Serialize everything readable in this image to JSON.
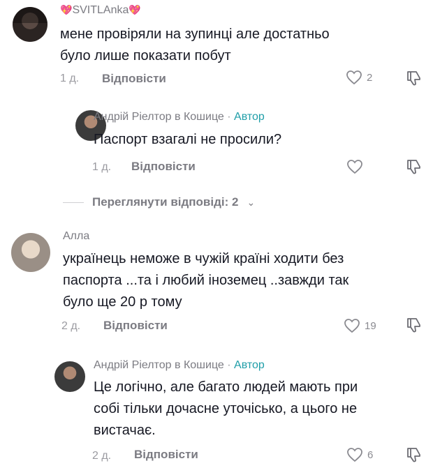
{
  "comments": [
    {
      "user": "SVITLAnka",
      "lines": [
        "мене провіряли на зупинці але достатньо",
        "було лише показати побут"
      ],
      "age": "1 д.",
      "reply": "Відповісти",
      "likes": "2"
    },
    {
      "user": "Андрій Ріелтор в Кошице",
      "author": "Автор",
      "lines": [
        "Паспорт взагалі не просили?"
      ],
      "age": "1 д.",
      "reply": "Відповісти",
      "likes": ""
    },
    {
      "user": "Алла",
      "lines": [
        "українець неможе в чужій країні ходити без",
        "паспорта ...та і любий іноземец ..завжди так",
        "було ще 20 р тому"
      ],
      "age": "2 д.",
      "reply": "Відповісти",
      "likes": "19"
    },
    {
      "user": "Андрій Ріелтор в Кошице",
      "author": "Автор",
      "lines": [
        "Це логічно, але багато людей мають при",
        "собі тільки дочасне уточісько, а цього не",
        "вистачає."
      ],
      "age": "2 д.",
      "reply": "Відповісти",
      "likes": "6"
    }
  ],
  "view_replies": "Переглянути відповіді: 2",
  "icons": {
    "like": "heart-outline-icon",
    "dislike": "thumbs-down-icon",
    "expand": "chevron-down-icon"
  },
  "colors": {
    "author": "#1f9ea8",
    "text": "#161823",
    "muted": "#7b7b82"
  }
}
